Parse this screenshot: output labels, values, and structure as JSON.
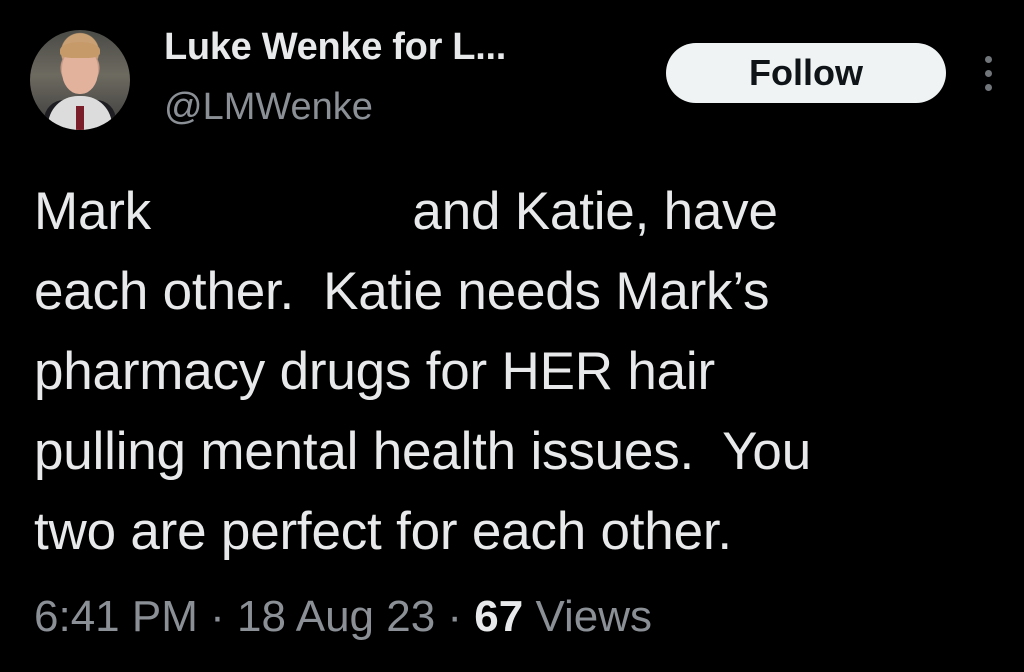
{
  "author": {
    "display_name": "Luke Wenke for L...",
    "handle": "@LMWenke"
  },
  "follow_button": {
    "label": "Follow"
  },
  "tweet": {
    "lines": [
      "Mark                  and Katie, have",
      "each other.  Katie needs Mark’s",
      "pharmacy drugs for HER hair",
      "pulling mental health issues.  You",
      "two are perfect for each other."
    ]
  },
  "meta": {
    "time": "6:41 PM",
    "sep1": " · ",
    "date": "18 Aug 23",
    "sep2": " · ",
    "views_count": "67",
    "views_label": " Views"
  },
  "icons": {
    "more": "more-vertical-icon",
    "avatar": "avatar"
  },
  "colors": {
    "background": "#000000",
    "text_primary": "#e7e9ea",
    "text_secondary": "#8b9096",
    "follow_bg": "#eff3f4",
    "follow_text": "#0f1419"
  }
}
